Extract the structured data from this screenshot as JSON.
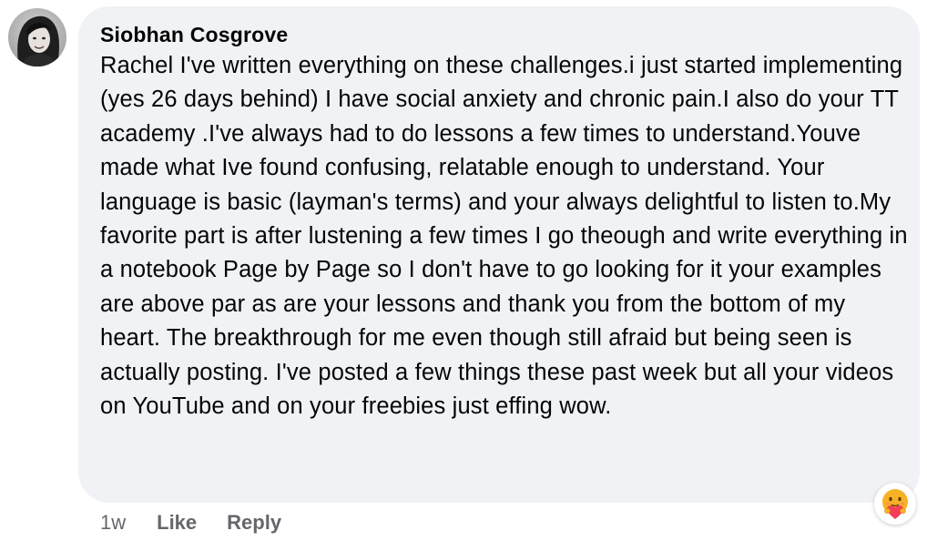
{
  "comment": {
    "author": "Siobhan Cosgrove",
    "text": "Rachel I've written everything on these challenges.i just started implementing (yes 26 days behind) I have social anxiety and chronic pain.I also do your TT academy .I've always had to do lessons a few times to understand.Youve made what Ive found confusing, relatable enough to understand. Your language is basic (layman's terms) and your always delightful to listen to.My favorite part is after lustening a few times I go theough and write everything in a notebook Page by Page so I don't have to go looking for it your examples are above par as are your lessons and thank you from the bottom of my heart. The breakthrough for me even though still afraid but being seen is actually posting. I've posted a few things these past week but all your videos on YouTube and on your freebies just effing wow.",
    "avatar_icon": "profile-photo",
    "reaction_icon": "care-reaction-icon"
  },
  "meta": {
    "timestamp": "1w",
    "like_label": "Like",
    "reply_label": "Reply"
  },
  "colors": {
    "bubble_bg": "#f0f2f5",
    "text": "#050505",
    "secondary_text": "#65676b",
    "reaction_yellow": "#f7b125",
    "reaction_heart": "#f33e58"
  }
}
